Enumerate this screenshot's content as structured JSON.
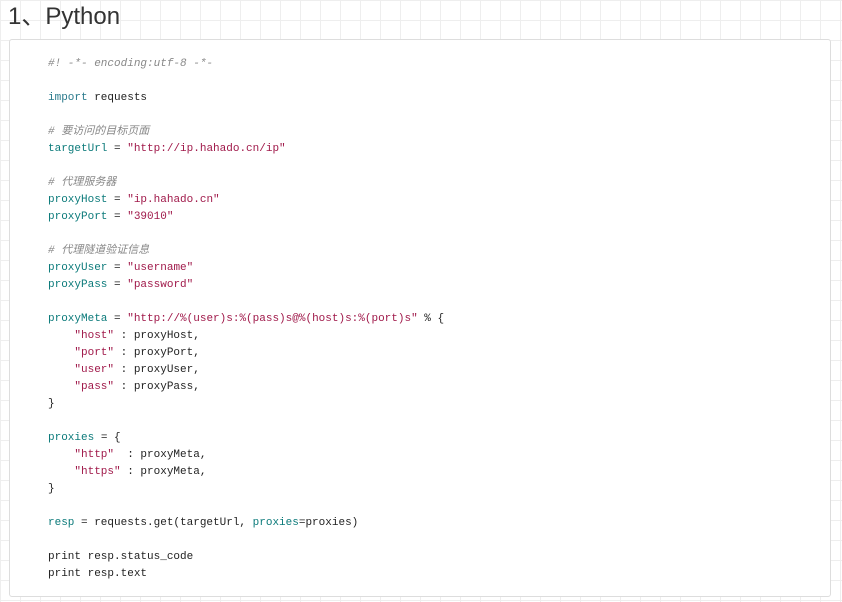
{
  "heading": "1、Python",
  "code": {
    "lines": [
      [
        {
          "t": "cm",
          "v": "#! -*- encoding:utf-8 -*-"
        }
      ],
      [],
      [
        {
          "t": "kw",
          "v": "import"
        },
        {
          "t": "txt",
          "v": " requests"
        }
      ],
      [],
      [
        {
          "t": "cm",
          "v": "# 要访问的目标页面"
        }
      ],
      [
        {
          "t": "var",
          "v": "targetUrl"
        },
        {
          "t": "txt",
          "v": " = "
        },
        {
          "t": "str",
          "v": "\"http://ip.hahado.cn/ip\""
        }
      ],
      [],
      [
        {
          "t": "cm",
          "v": "# 代理服务器"
        }
      ],
      [
        {
          "t": "var",
          "v": "proxyHost"
        },
        {
          "t": "txt",
          "v": " = "
        },
        {
          "t": "str",
          "v": "\"ip.hahado.cn\""
        }
      ],
      [
        {
          "t": "var",
          "v": "proxyPort"
        },
        {
          "t": "txt",
          "v": " = "
        },
        {
          "t": "str",
          "v": "\"39010\""
        }
      ],
      [],
      [
        {
          "t": "cm",
          "v": "# 代理隧道验证信息"
        }
      ],
      [
        {
          "t": "var",
          "v": "proxyUser"
        },
        {
          "t": "txt",
          "v": " = "
        },
        {
          "t": "str",
          "v": "\"username\""
        }
      ],
      [
        {
          "t": "var",
          "v": "proxyPass"
        },
        {
          "t": "txt",
          "v": " = "
        },
        {
          "t": "str",
          "v": "\"password\""
        }
      ],
      [],
      [
        {
          "t": "var",
          "v": "proxyMeta"
        },
        {
          "t": "txt",
          "v": " = "
        },
        {
          "t": "str",
          "v": "\"http://%(user)s:%(pass)s@%(host)s:%(port)s\""
        },
        {
          "t": "txt",
          "v": " % {"
        }
      ],
      [
        {
          "t": "txt",
          "v": "    "
        },
        {
          "t": "str",
          "v": "\"host\""
        },
        {
          "t": "txt",
          "v": " : proxyHost,"
        }
      ],
      [
        {
          "t": "txt",
          "v": "    "
        },
        {
          "t": "str",
          "v": "\"port\""
        },
        {
          "t": "txt",
          "v": " : proxyPort,"
        }
      ],
      [
        {
          "t": "txt",
          "v": "    "
        },
        {
          "t": "str",
          "v": "\"user\""
        },
        {
          "t": "txt",
          "v": " : proxyUser,"
        }
      ],
      [
        {
          "t": "txt",
          "v": "    "
        },
        {
          "t": "str",
          "v": "\"pass\""
        },
        {
          "t": "txt",
          "v": " : proxyPass,"
        }
      ],
      [
        {
          "t": "txt",
          "v": "}"
        }
      ],
      [],
      [
        {
          "t": "var",
          "v": "proxies"
        },
        {
          "t": "txt",
          "v": " = {"
        }
      ],
      [
        {
          "t": "txt",
          "v": "    "
        },
        {
          "t": "str",
          "v": "\"http\""
        },
        {
          "t": "txt",
          "v": "  : proxyMeta,"
        }
      ],
      [
        {
          "t": "txt",
          "v": "    "
        },
        {
          "t": "str",
          "v": "\"https\""
        },
        {
          "t": "txt",
          "v": " : proxyMeta,"
        }
      ],
      [
        {
          "t": "txt",
          "v": "}"
        }
      ],
      [],
      [
        {
          "t": "var",
          "v": "resp"
        },
        {
          "t": "txt",
          "v": " = requests.get(targetUrl, "
        },
        {
          "t": "var",
          "v": "proxies"
        },
        {
          "t": "txt",
          "v": "=proxies)"
        }
      ],
      [],
      [
        {
          "t": "txt",
          "v": "print resp.status_code"
        }
      ],
      [
        {
          "t": "txt",
          "v": "print resp.text"
        }
      ]
    ]
  }
}
